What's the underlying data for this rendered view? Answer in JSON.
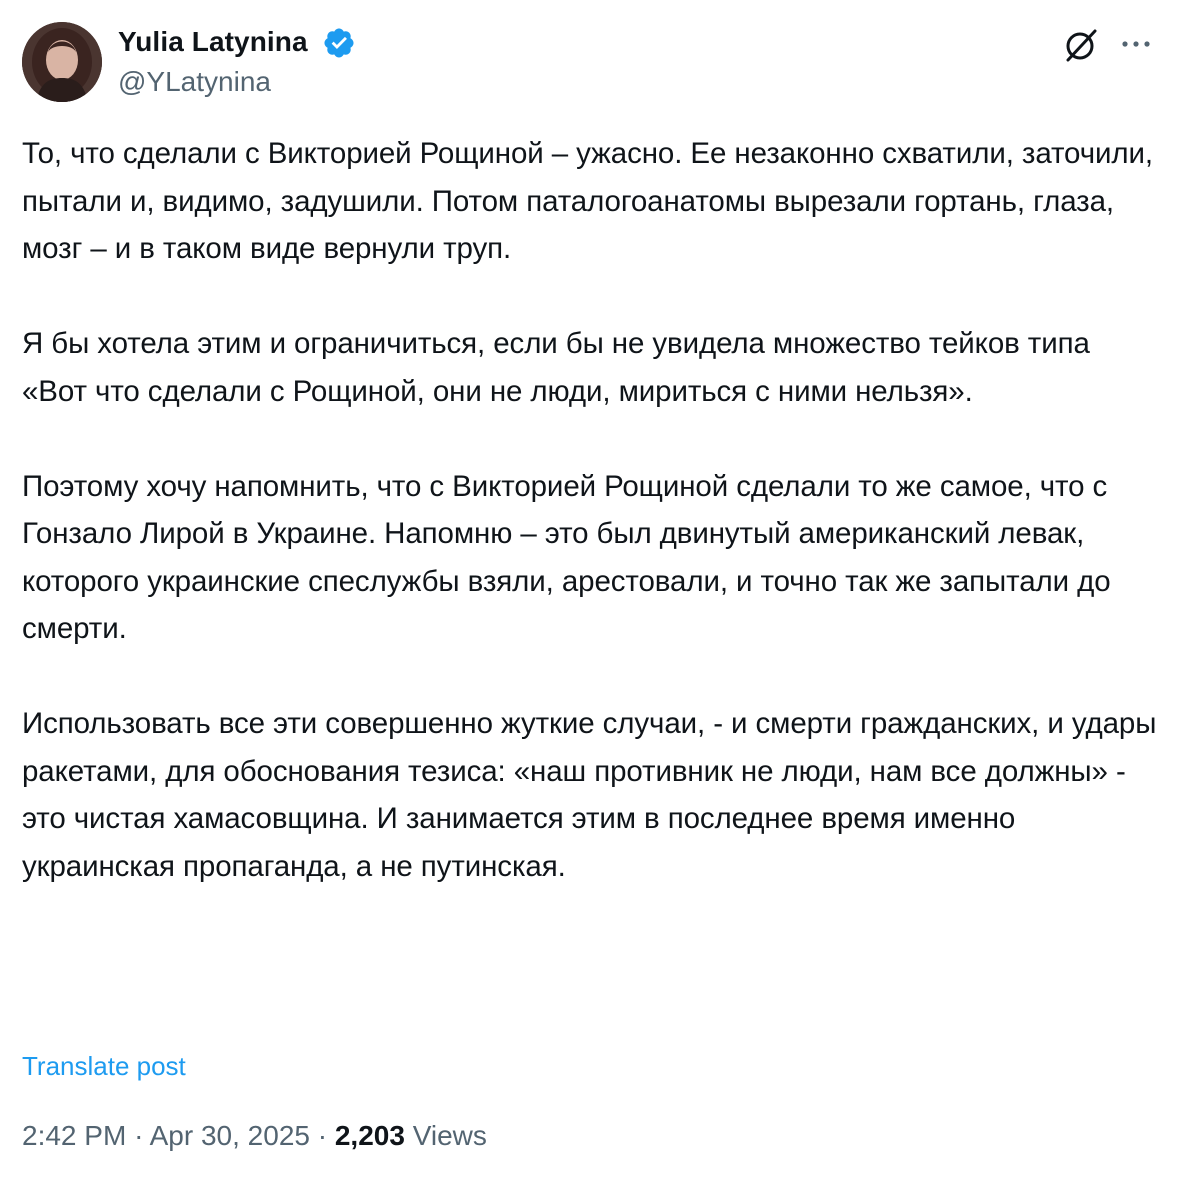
{
  "author": {
    "name": "Yulia Latynina",
    "handle": "@YLatynina"
  },
  "icons": {
    "avatar": "profile-photo",
    "verified": "verified-badge-icon",
    "grok": "grok-icon",
    "more": "more-icon"
  },
  "colors": {
    "accent": "#1d9bf0",
    "text": "#0f1419",
    "secondary": "#536471"
  },
  "post": {
    "paragraphs": [
      "То, что сделали с Викторией Рощиной – ужасно. Ее незаконно схватили, заточили, пытали и, видимо, задушили. Потом паталогоанатомы вырезали гортань, глаза, мозг – и в таком виде вернули труп.",
      "Я бы хотела этим и ограничиться, если бы не увидела множество тейков типа «Вот что сделали с Рощиной, они не люди, мириться с ними нельзя».",
      "Поэтому хочу напомнить, что с Викторией Рощиной сделали то же самое, что с Гонзало Лирой в Украине. Напомню – это был двинутый американский левак, которого украинские спеслужбы взяли, арестовали, и точно так же запытали до смерти.",
      "Использовать все эти совершенно жуткие случаи, - и смерти гражданских, и удары ракетами, для обоснования тезиса: «наш противник не люди, нам все должны» - это чистая хамасовщина. И занимается этим в последнее время именно украинская пропаганда, а не путинская."
    ],
    "translate_label": "Translate post"
  },
  "meta": {
    "time": "2:42 PM",
    "separator": "·",
    "date": "Apr 30, 2025",
    "views_count": "2,203",
    "views_label": "Views"
  }
}
